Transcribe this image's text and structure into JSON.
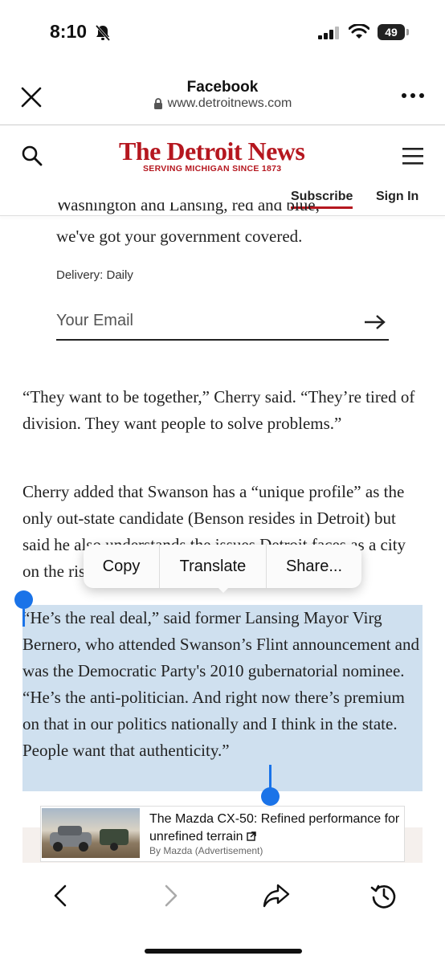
{
  "status_bar": {
    "time": "8:10",
    "battery": "49"
  },
  "browser": {
    "title": "Facebook",
    "url": "www.detroitnews.com"
  },
  "site": {
    "masthead": "The Detroit News",
    "tagline": "SERVING MICHIGAN SINCE 1873",
    "subscribe": "Subscribe",
    "sign_in": "Sign In"
  },
  "newsletter": {
    "cut_text": "Washington and Lansing, red and blue,",
    "line": "we've got your government covered.",
    "delivery": "Delivery: Daily",
    "email_placeholder": "Your Email"
  },
  "article": {
    "p1": "“They want to be together,” Cherry said. “They’re tired of division. They want people to solve problems.”",
    "p2": "Cherry added that Swanson has a “unique profile” as the only out-state candidate (Benson resides in Detroit) but said he also understands the issues Detroit faces as a city on the rise.",
    "p3": "“He’s the real deal,” said former Lansing Mayor Virg Bernero, who attended Swanson’s Flint announcement and was the Democratic Party's 2010 gubernatorial nominee. “He’s the anti-politician. And right now there’s premium on that in our politics nationally and I think in the state. People want that authenticity.”"
  },
  "context_menu": {
    "items": [
      "Copy",
      "Translate",
      "Share..."
    ]
  },
  "ad": {
    "title": "The Mazda CX-50: Refined performance for unrefined terrain",
    "by": "By Mazda (Advertisement)"
  },
  "colors": {
    "brand_red": "#b5171f",
    "selection": "#cfe0ef",
    "handle_blue": "#1a73e8"
  }
}
